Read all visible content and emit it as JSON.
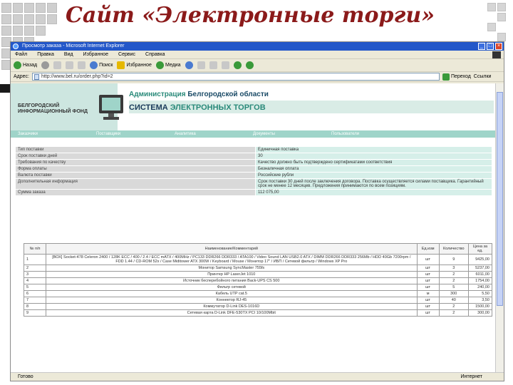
{
  "slide": {
    "title": "Сайт «Электронные торги»"
  },
  "browser": {
    "window_title": "Просмотр заказа - Microsoft Internet Explorer",
    "menu": [
      "Файл",
      "Правка",
      "Вид",
      "Избранное",
      "Сервис",
      "Справка"
    ],
    "toolbar": {
      "back": "Назад",
      "search": "Поиск",
      "favorites": "Избранное",
      "media": "Медиа"
    },
    "address": {
      "label": "Адрес:",
      "value": "http://www.bel.ru/order.php?id=2",
      "go": "Переход",
      "links": "Ссылки"
    },
    "status": {
      "left": "Готово",
      "zone": "Интернет"
    }
  },
  "site": {
    "fund": [
      "БЕЛГОРОДСКИЙ",
      "ИНФОРМАЦИОННЫЙ ФОНД"
    ],
    "admin_title": {
      "part1": "Администрация",
      "part2": "Белгородской области"
    },
    "system_title": {
      "part1": "СИСТЕМА",
      "part2": "ЭЛЕКТРОННЫХ ТОРГОВ"
    },
    "nav": [
      "Заказчики",
      "Поставщики",
      "Аналитика",
      "Документы",
      "Пользователи"
    ]
  },
  "info": [
    {
      "k": "Тип поставки",
      "v": "Единичная поставка"
    },
    {
      "k": "Срок поставки дней",
      "v": "30"
    },
    {
      "k": "Требования по качеству",
      "v": "Качество должно быть подтверждено сертификатами соответствия"
    },
    {
      "k": "Форма оплаты",
      "v": "Безналичная оплата"
    },
    {
      "k": "Валюта поставки",
      "v": "Российские рубли"
    },
    {
      "k": "Дополнительная информация",
      "v": "Срок поставки 30 дней после заключения договора. Поставка осуществляется силами поставщика. Гарантийный срок не менее 12 месяцев. Предложения принимаются по всем позициям."
    },
    {
      "k": "Сумма заказа",
      "v": "112 075,00"
    }
  ],
  "items": {
    "headers": {
      "n": "№ п/п",
      "name": "Наименование/Комментарий",
      "unit": "Ед.изм",
      "qty": "Количество",
      "price": "Цена за ед."
    },
    "rows": [
      {
        "n": "1",
        "name": "[ВОХ] Socket-478 Celeron 2400 / 128K ECC / 400 / 2.4 / ECC mATX / 400MHz / PC133 DDR266 DDR333 / ATA100 / Video Sound LAN USB2.0 ATX / DIMM DDR266 DDR333 256Mb / HDD 40Gb 7200rpm / FDD 1.44 / CD-ROM 52x / Case Miditower ATX 300W / Keyboard / Mouse / Монитор 17\" / ИБП / Сетевой фильтр / Windows XP Pro",
        "unit": "шт",
        "qty": "9",
        "price": "9425,00"
      },
      {
        "n": "2",
        "name": "Монитор Samsung SyncMaster 755fs",
        "unit": "шт",
        "qty": "3",
        "price": "5237,00"
      },
      {
        "n": "3",
        "name": "Принтер HP LaserJet 1010",
        "unit": "шт",
        "qty": "2",
        "price": "6011,00"
      },
      {
        "n": "4",
        "name": "Источник бесперебойного питания Back-UPS CS 500",
        "unit": "шт",
        "qty": "2",
        "price": "1754,00"
      },
      {
        "n": "5",
        "name": "Фильтр сетевой",
        "unit": "шт",
        "qty": "5",
        "price": "240,00"
      },
      {
        "n": "6",
        "name": "Кабель UTP cat.5",
        "unit": "м",
        "qty": "300",
        "price": "5,50"
      },
      {
        "n": "7",
        "name": "Коннектор RJ-45",
        "unit": "шт",
        "qty": "40",
        "price": "3,50"
      },
      {
        "n": "8",
        "name": "Коммутатор D-Link DES-1016D",
        "unit": "шт",
        "qty": "2",
        "price": "1500,00"
      },
      {
        "n": "9",
        "name": "Сетевая карта D-Link DFE-530TX PCI 10/100Mbit",
        "unit": "шт",
        "qty": "2",
        "price": "300,00"
      }
    ]
  }
}
